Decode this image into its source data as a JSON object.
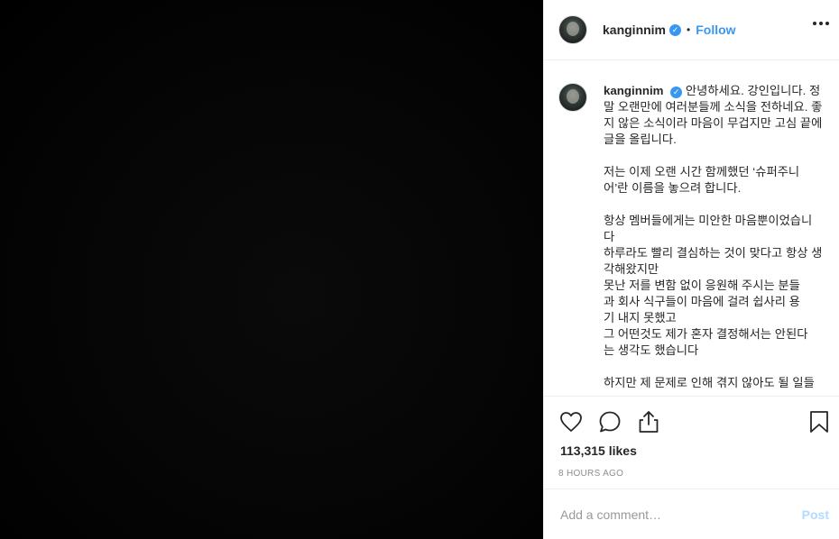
{
  "post": {
    "username": "kanginnim",
    "verified_badge": "✓",
    "separator": "•",
    "follow_label": "Follow"
  },
  "caption": {
    "username": "kanginnim",
    "text": "안녕하세요. 강인입니다. 정말 오랜만에 여러분들께 소식을 전하네요. 좋지 않은 소식이라 마음이 무겁지만 고심 끝에 글을 올립니다.\n\n저는 이제 오랜 시간 함께했던 ‘슈퍼주니\n어’란 이름을 놓으려 합니다.\n\n항상 멤버들에게는 미안한 마음뿐이었습니\n다\n하루라도 빨리 결심하는 것이 맞다고 항상 생\n각해왔지만\n못난 저를 변함 없이 응원해 주시는 분들\n과 회사 식구들이 마음에 걸려 쉽사리 용\n기 내지 못했고\n그 어떤것도 제가 혼자 결정해서는 안된다\n는 생각도 했습니다\n\n하지만 제 문제로 인해 겪지 않아도 될 일들"
  },
  "engagement": {
    "likes": "113,315 likes",
    "timestamp": "8 HOURS AGO"
  },
  "comment": {
    "placeholder": "Add a comment…",
    "post_label": "Post"
  },
  "icons": {
    "like": "heart-icon",
    "comment": "comment-icon",
    "share": "share-icon",
    "save": "bookmark-icon",
    "more": "more-options-icon"
  },
  "colors": {
    "accent": "#3897f0",
    "post_disabled": "#b3dbff",
    "muted": "#8e8e8e"
  }
}
